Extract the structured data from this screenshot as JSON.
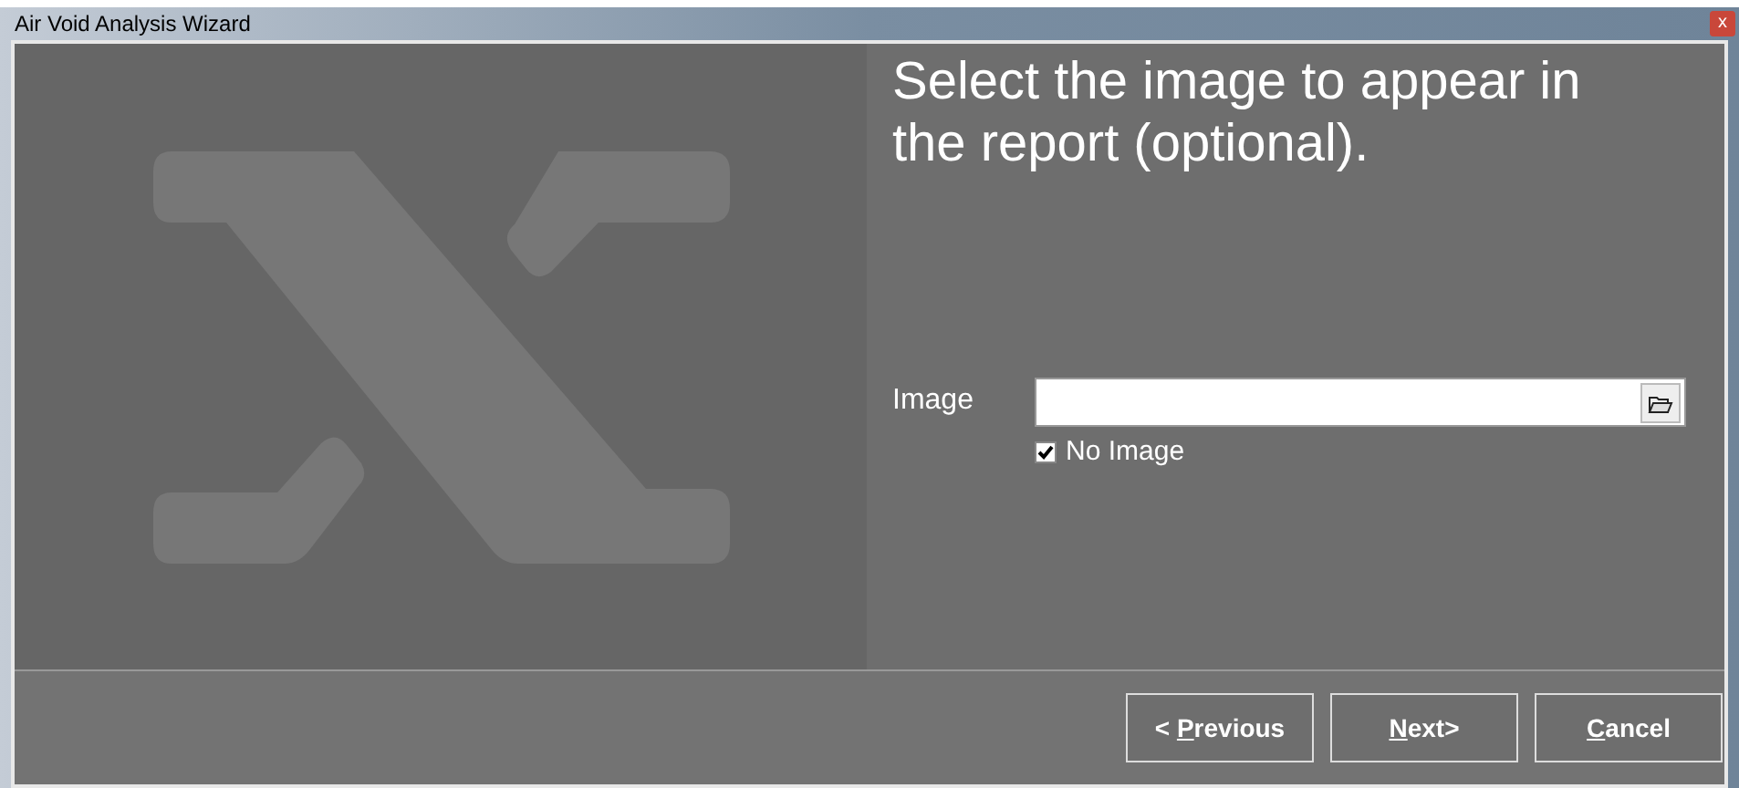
{
  "window": {
    "title": "Air Void Analysis Wizard",
    "close_button": "x"
  },
  "heading": "Select the image to appear in the report (optional).",
  "image_field": {
    "label": "Image"
  },
  "no_image": {
    "label": "No Image",
    "checked": true
  },
  "buttons": [
    {
      "label_parts": {
        "before": "< ",
        "access_key": "P",
        "after": "revious"
      }
    },
    {
      "label_parts": {
        "access_key": "N",
        "after": "ext>"
      }
    },
    {
      "label_parts": {
        "access_key": "C",
        "after": "ancel"
      }
    }
  ]
}
